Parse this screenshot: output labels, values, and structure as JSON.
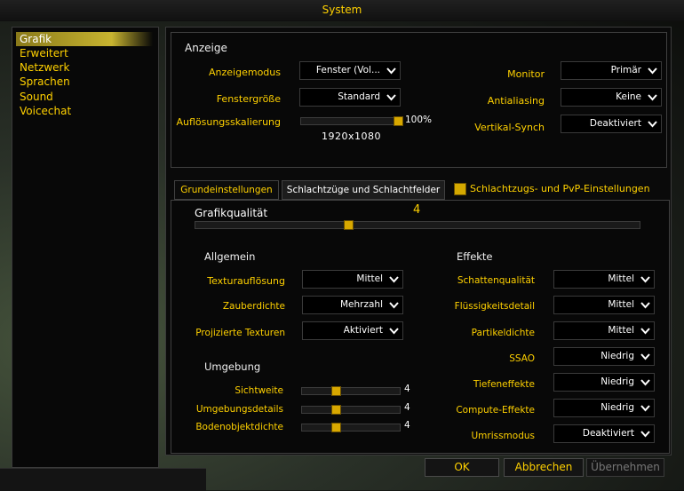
{
  "window": {
    "title": "System"
  },
  "nav": {
    "items": [
      "Grafik",
      "Erweitert",
      "Netzwerk",
      "Sprachen",
      "Sound",
      "Voicechat"
    ],
    "active": "Grafik"
  },
  "display": {
    "heading": "Anzeige",
    "mode_label": "Anzeigemodus",
    "mode_value": "Fenster (Vol...",
    "size_label": "Fenstergröße",
    "size_value": "Standard",
    "scale_label": "Auflösungsskalierung",
    "scale_percent": "100%",
    "scale_level": 1.0,
    "resolution": "1920x1080",
    "monitor_label": "Monitor",
    "monitor_value": "Primär",
    "aa_label": "Antialiasing",
    "aa_value": "Keine",
    "vsync_label": "Vertikal-Synch",
    "vsync_value": "Deaktiviert"
  },
  "tabs": {
    "basic": "Grundeinstellungen",
    "raid": "Schlachtzüge und Schlachtfelder",
    "raid_pvp_checkbox": "Schlachtzugs- und PvP-Einstellungen",
    "raid_pvp_checked": true
  },
  "quality": {
    "label": "Grafikqualität",
    "value": "4",
    "level": 0.34
  },
  "general": {
    "heading": "Allgemein",
    "texture_label": "Texturauflösung",
    "texture_value": "Mittel",
    "spell_label": "Zauberdichte",
    "spell_value": "Mehrzahl",
    "projected_label": "Projizierte Texturen",
    "projected_value": "Aktiviert"
  },
  "environment": {
    "heading": "Umgebung",
    "view_label": "Sichtweite",
    "view_value": "4",
    "view_level": 0.33,
    "detail_label": "Umgebungsdetails",
    "detail_value": "4",
    "detail_level": 0.33,
    "ground_label": "Bodenobjektdichte",
    "ground_value": "4",
    "ground_level": 0.33
  },
  "effects": {
    "heading": "Effekte",
    "shadow_label": "Schattenqualität",
    "shadow_value": "Mittel",
    "liquid_label": "Flüssigkeitsdetail",
    "liquid_value": "Mittel",
    "particle_label": "Partikeldichte",
    "particle_value": "Mittel",
    "ssao_label": "SSAO",
    "ssao_value": "Niedrig",
    "dof_label": "Tiefeneffekte",
    "dof_value": "Niedrig",
    "compute_label": "Compute-Effekte",
    "compute_value": "Niedrig",
    "outline_label": "Umrissmodus",
    "outline_value": "Deaktiviert"
  },
  "buttons": {
    "ok": "OK",
    "cancel": "Abbrechen",
    "apply": "Übernehmen"
  },
  "colors": {
    "accent": "#ffd100",
    "slider": "#d8a800"
  },
  "icons": {
    "dropdown": "chevron-down-icon",
    "checkbox": "checkbox-checked-icon"
  }
}
